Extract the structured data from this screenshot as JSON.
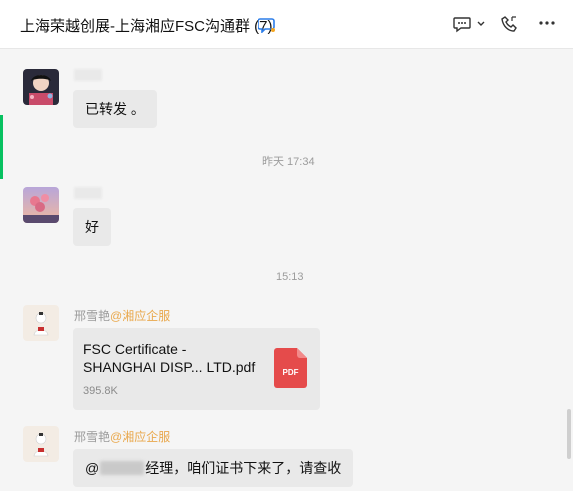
{
  "header": {
    "title": "上海荣越创展-上海湘应FSC沟通群 (7)",
    "icons": [
      "chat-bubble-icon",
      "more-chat-icon",
      "chevron-down-icon",
      "phone-icon",
      "more-icon"
    ]
  },
  "messages": {
    "msg1": {
      "text": "已转发 。"
    },
    "time1": "昨天 17:34",
    "msg2": {
      "text": "好"
    },
    "time2": "15:13",
    "msg3": {
      "sender_name": "邢雪艳",
      "sender_tag": "@湘应企服",
      "file_name": "FSC Certificate - SHANGHAI DISP... LTD.pdf",
      "file_size": "395.8K",
      "file_type": "PDF"
    },
    "msg4": {
      "sender_name": "邢雪艳",
      "sender_tag": "@湘应企服",
      "text_prefix": "@",
      "text_suffix": "经理，咱们证书下来了，请查收"
    }
  },
  "colors": {
    "accent_green": "#07c160",
    "tag_orange": "#e9a84c",
    "pdf_red": "#e54b4b"
  }
}
